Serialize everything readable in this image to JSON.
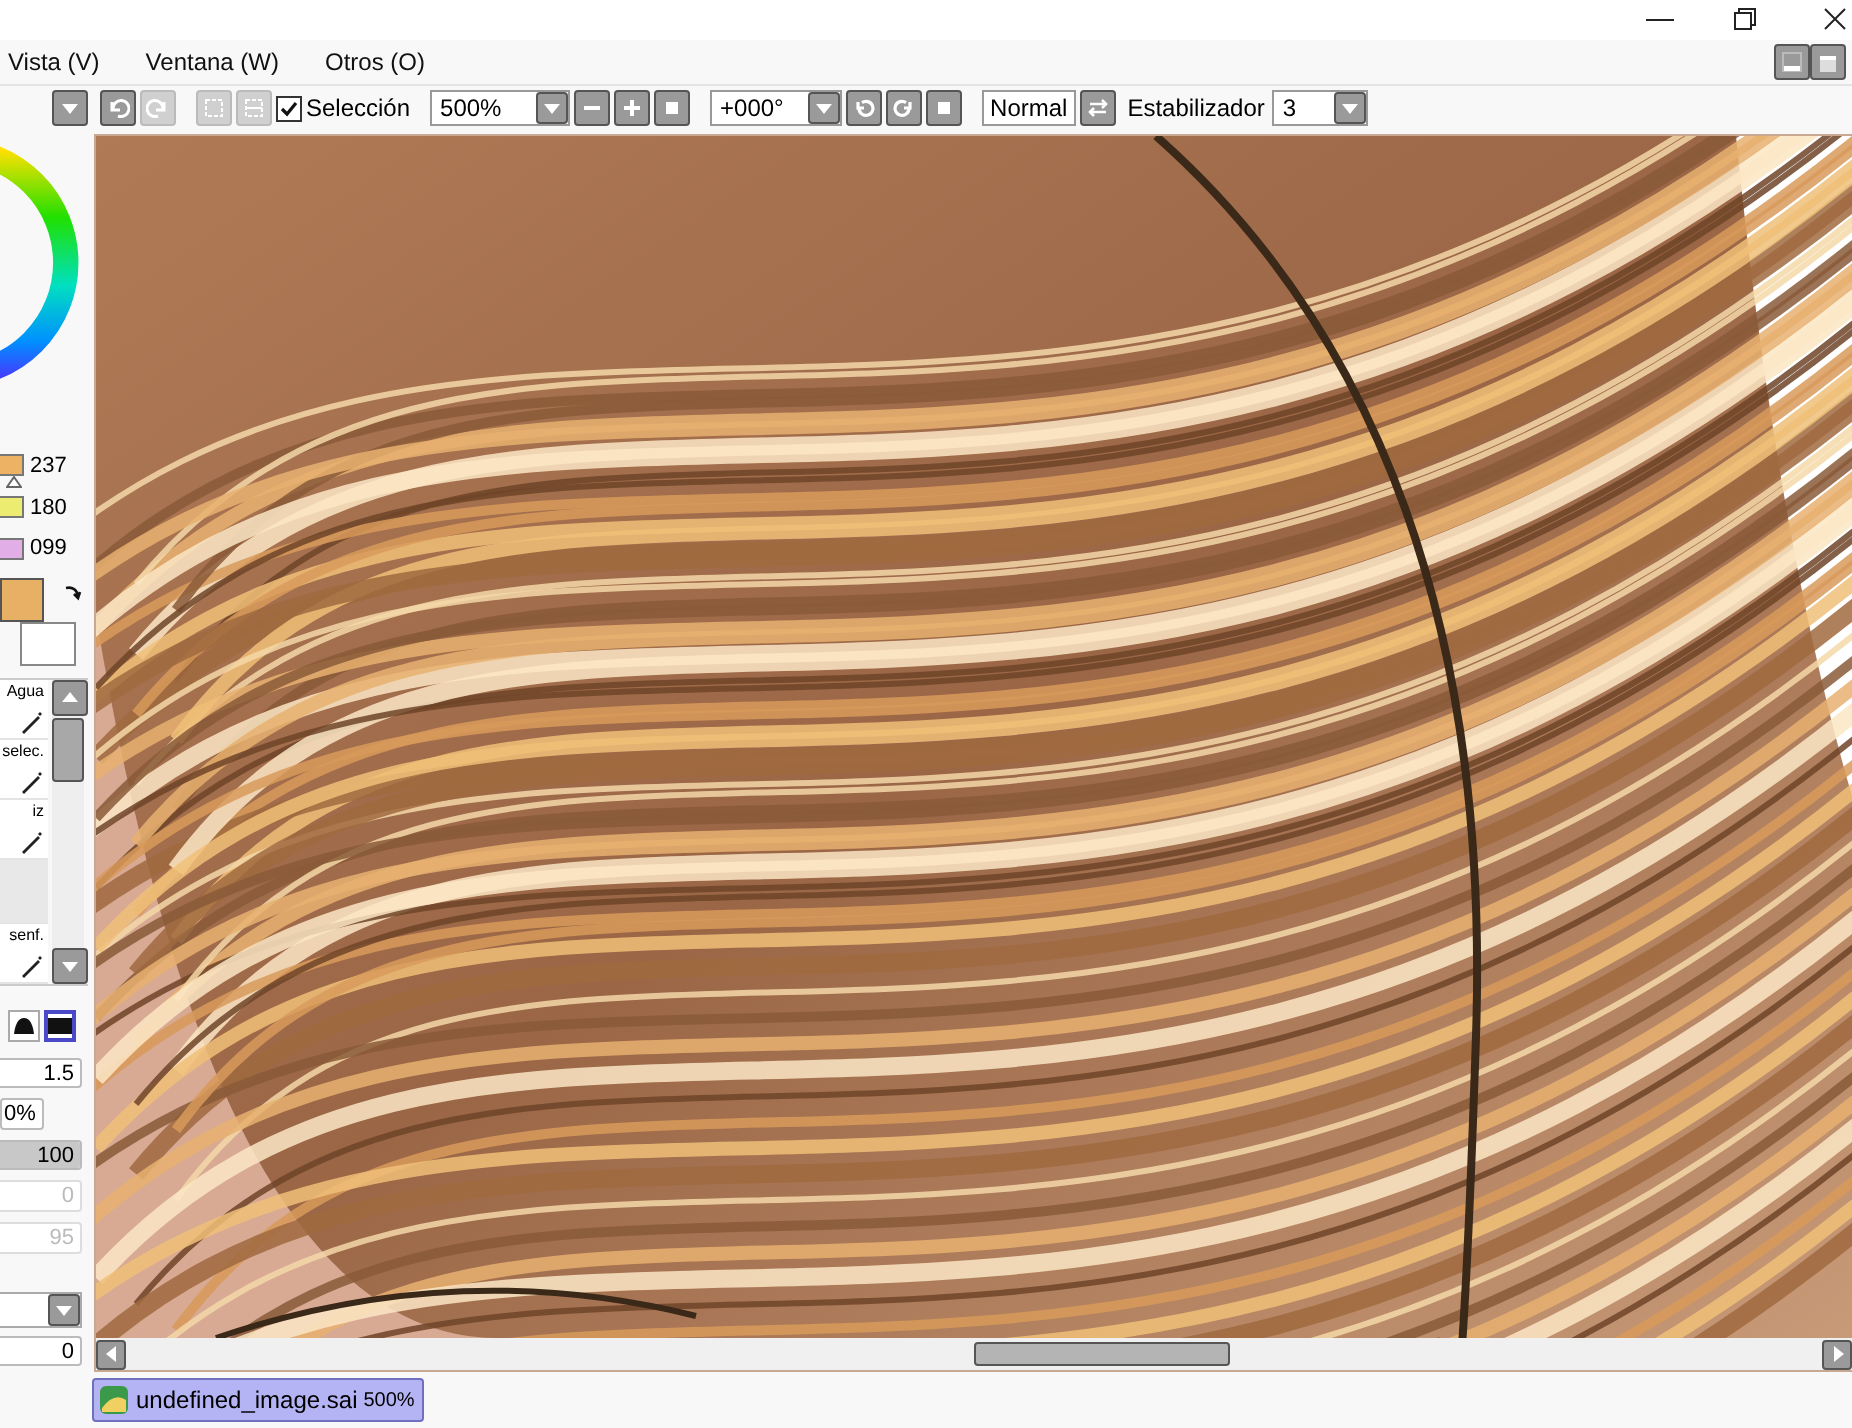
{
  "menu": [
    {
      "label": "Vista (V)"
    },
    {
      "label": "Ventana (W)"
    },
    {
      "label": "Otros (O)"
    }
  ],
  "toolbar": {
    "selection": {
      "label": "Selección",
      "checked": true
    },
    "zoom": "500%",
    "rotation": "+000°",
    "blend": "Normal",
    "stabilizer_label": "Estabilizador",
    "stabilizer": "3"
  },
  "color_sliders": [
    {
      "value": "237",
      "color": "#eeb264",
      "marker": true
    },
    {
      "value": "180",
      "color": "#ecec70",
      "marker": false
    },
    {
      "value": "099",
      "color": "#e2aee8",
      "marker": false
    }
  ],
  "current_color": {
    "color": "#e8b064"
  },
  "tools": [
    {
      "label": "Agua",
      "selected": false
    },
    {
      "label": "selec.",
      "selected": false
    },
    {
      "label": "iz",
      "selected": false
    },
    {
      "selected": true
    },
    {
      "label": "senf.",
      "selected": false
    }
  ],
  "brush_shapes": [
    {
      "selected": false
    },
    {
      "selected": true
    }
  ],
  "fields": [
    {
      "kind": "number",
      "value": "1.5",
      "disabled": false
    },
    {
      "kind": "percent",
      "value": "0%",
      "disabled": false
    },
    {
      "kind": "slider",
      "value": "100",
      "level": 1,
      "disabled": false
    },
    {
      "kind": "slider",
      "value": "0",
      "level": 0,
      "disabled": true
    },
    {
      "kind": "slider",
      "value": "95",
      "level": 0,
      "disabled": true
    }
  ],
  "bottom_value": "0",
  "document_tabs": [
    {
      "name": "undefined_image.sai",
      "zoom": "500%",
      "selected": true
    }
  ]
}
